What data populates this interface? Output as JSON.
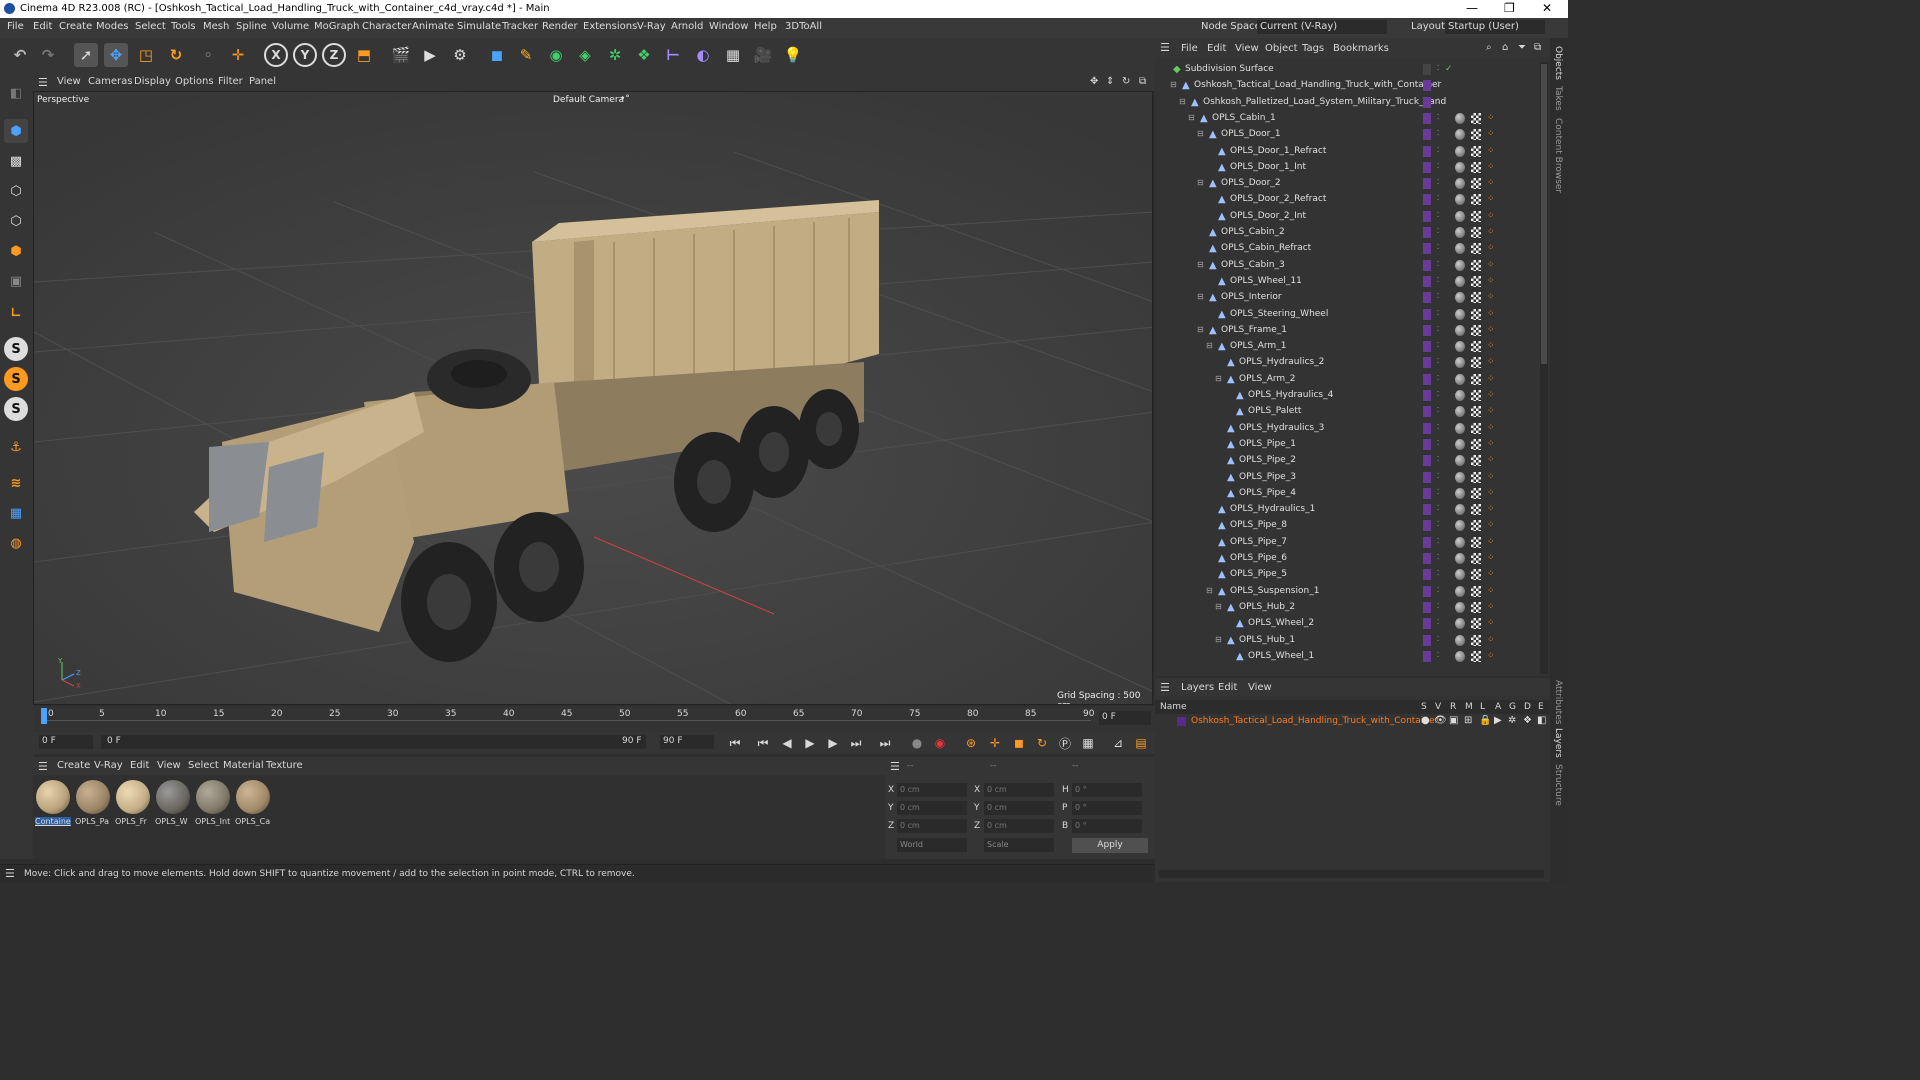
{
  "window": {
    "title": "Cinema 4D R23.008 (RC) - [Oshkosh_Tactical_Load_Handling_Truck_with_Container_c4d_vray.c4d *] - Main",
    "minimize": "—",
    "maximize": "❐",
    "close": "✕"
  },
  "menubar": {
    "items": [
      "File",
      "Edit",
      "Create",
      "Modes",
      "Select",
      "Tools",
      "Mesh",
      "Spline",
      "Volume",
      "MoGraph",
      "Character",
      "Animate",
      "Simulate",
      "Tracker",
      "Render",
      "Extensions",
      "V-Ray",
      "Arnold",
      "Window",
      "Help",
      "3DToAll"
    ],
    "node_space_label": "Node Space:",
    "node_space_value": "Current (V-Ray)",
    "layout_label": "Layout:",
    "layout_value": "Startup (User)"
  },
  "viewport": {
    "menu": [
      "View",
      "Cameras",
      "Display",
      "Options",
      "Filter",
      "Panel"
    ],
    "label": "Perspective",
    "camera": "Default Camera",
    "camera_icon": "•°",
    "grid_spacing": "Grid Spacing : 500 cm",
    "axis_y": "Y",
    "axis_z": "Z",
    "axis_x": "X"
  },
  "timeline": {
    "ticks": [
      "0",
      "5",
      "10",
      "15",
      "20",
      "25",
      "30",
      "35",
      "40",
      "45",
      "50",
      "55",
      "60",
      "65",
      "70",
      "75",
      "80",
      "85",
      "90"
    ],
    "current": "0 F"
  },
  "transport": {
    "start": "0 F",
    "range_start": "0 F",
    "range_end": "90 F",
    "end": "90 F"
  },
  "materials": {
    "menu": [
      "Create",
      "V-Ray",
      "Edit",
      "View",
      "Select",
      "Material",
      "Texture"
    ],
    "items": [
      {
        "label": "Containe",
        "color": "#b8a07a"
      },
      {
        "label": "OPLS_Pa",
        "color": "#9a8466"
      },
      {
        "label": "OPLS_Fr",
        "color": "#c4ad86"
      },
      {
        "label": "OPLS_W",
        "color": "#6a6660"
      },
      {
        "label": "OPLS_Int",
        "color": "#807868"
      },
      {
        "label": "OPLS_Ca",
        "color": "#a08a6a"
      }
    ]
  },
  "coords": {
    "header": [
      "--",
      "--",
      "--"
    ],
    "rows": [
      {
        "a": "X",
        "av": "0 cm",
        "b": "X",
        "bv": "0 cm",
        "c": "H",
        "cv": "0 °"
      },
      {
        "a": "Y",
        "av": "0 cm",
        "b": "Y",
        "bv": "0 cm",
        "c": "P",
        "cv": "0 °"
      },
      {
        "a": "Z",
        "av": "0 cm",
        "b": "Z",
        "bv": "0 cm",
        "c": "B",
        "cv": "0 °"
      }
    ],
    "world": "World",
    "scale": "Scale",
    "apply": "Apply"
  },
  "status": {
    "text": "Move: Click and drag to move elements. Hold down SHIFT to quantize movement / add to the selection in point mode, CTRL to remove."
  },
  "objects": {
    "menu": [
      "File",
      "Edit",
      "View",
      "Object",
      "Tags",
      "Bookmarks"
    ],
    "rows": [
      {
        "name": "Subdivision Surface",
        "indent": 0,
        "icon": "◆",
        "iconcolor": "#5fcf5f",
        "tags": false
      },
      {
        "name": "Oshkosh_Tactical_Load_Handling_Truck_with_Container",
        "indent": 1,
        "icon": "▲",
        "iconcolor": "#9ec0ff",
        "tags": false
      },
      {
        "name": "Oshkosh_Palletized_Load_System_Military_Truck_Sand",
        "indent": 2,
        "icon": "▲",
        "iconcolor": "#9ec0ff",
        "tags": false
      },
      {
        "name": "OPLS_Cabin_1",
        "indent": 3,
        "icon": "▲",
        "iconcolor": "#9ec0ff",
        "tags": true
      },
      {
        "name": "OPLS_Door_1",
        "indent": 4,
        "icon": "▲",
        "iconcolor": "#9ec0ff",
        "tags": true
      },
      {
        "name": "OPLS_Door_1_Refract",
        "indent": 5,
        "icon": "▲",
        "iconcolor": "#9ec0ff",
        "tags": true
      },
      {
        "name": "OPLS_Door_1_Int",
        "indent": 5,
        "icon": "▲",
        "iconcolor": "#9ec0ff",
        "tags": true
      },
      {
        "name": "OPLS_Door_2",
        "indent": 4,
        "icon": "▲",
        "iconcolor": "#9ec0ff",
        "tags": true
      },
      {
        "name": "OPLS_Door_2_Refract",
        "indent": 5,
        "icon": "▲",
        "iconcolor": "#9ec0ff",
        "tags": true
      },
      {
        "name": "OPLS_Door_2_Int",
        "indent": 5,
        "icon": "▲",
        "iconcolor": "#9ec0ff",
        "tags": true
      },
      {
        "name": "OPLS_Cabin_2",
        "indent": 4,
        "icon": "▲",
        "iconcolor": "#9ec0ff",
        "tags": true
      },
      {
        "name": "OPLS_Cabin_Refract",
        "indent": 4,
        "icon": "▲",
        "iconcolor": "#9ec0ff",
        "tags": true
      },
      {
        "name": "OPLS_Cabin_3",
        "indent": 4,
        "icon": "▲",
        "iconcolor": "#9ec0ff",
        "tags": true
      },
      {
        "name": "OPLS_Wheel_11",
        "indent": 5,
        "icon": "▲",
        "iconcolor": "#9ec0ff",
        "tags": true
      },
      {
        "name": "OPLS_Interior",
        "indent": 4,
        "icon": "▲",
        "iconcolor": "#9ec0ff",
        "tags": true
      },
      {
        "name": "OPLS_Steering_Wheel",
        "indent": 5,
        "icon": "▲",
        "iconcolor": "#9ec0ff",
        "tags": true
      },
      {
        "name": "OPLS_Frame_1",
        "indent": 4,
        "icon": "▲",
        "iconcolor": "#9ec0ff",
        "tags": true
      },
      {
        "name": "OPLS_Arm_1",
        "indent": 5,
        "icon": "▲",
        "iconcolor": "#9ec0ff",
        "tags": true
      },
      {
        "name": "OPLS_Hydraulics_2",
        "indent": 6,
        "icon": "▲",
        "iconcolor": "#9ec0ff",
        "tags": true
      },
      {
        "name": "OPLS_Arm_2",
        "indent": 6,
        "icon": "▲",
        "iconcolor": "#9ec0ff",
        "tags": true
      },
      {
        "name": "OPLS_Hydraulics_4",
        "indent": 7,
        "icon": "▲",
        "iconcolor": "#9ec0ff",
        "tags": true
      },
      {
        "name": "OPLS_Palett",
        "indent": 7,
        "icon": "▲",
        "iconcolor": "#9ec0ff",
        "tags": true
      },
      {
        "name": "OPLS_Hydraulics_3",
        "indent": 6,
        "icon": "▲",
        "iconcolor": "#9ec0ff",
        "tags": true
      },
      {
        "name": "OPLS_Pipe_1",
        "indent": 6,
        "icon": "▲",
        "iconcolor": "#9ec0ff",
        "tags": true
      },
      {
        "name": "OPLS_Pipe_2",
        "indent": 6,
        "icon": "▲",
        "iconcolor": "#9ec0ff",
        "tags": true
      },
      {
        "name": "OPLS_Pipe_3",
        "indent": 6,
        "icon": "▲",
        "iconcolor": "#9ec0ff",
        "tags": true
      },
      {
        "name": "OPLS_Pipe_4",
        "indent": 6,
        "icon": "▲",
        "iconcolor": "#9ec0ff",
        "tags": true
      },
      {
        "name": "OPLS_Hydraulics_1",
        "indent": 5,
        "icon": "▲",
        "iconcolor": "#9ec0ff",
        "tags": true
      },
      {
        "name": "OPLS_Pipe_8",
        "indent": 5,
        "icon": "▲",
        "iconcolor": "#9ec0ff",
        "tags": true
      },
      {
        "name": "OPLS_Pipe_7",
        "indent": 5,
        "icon": "▲",
        "iconcolor": "#9ec0ff",
        "tags": true
      },
      {
        "name": "OPLS_Pipe_6",
        "indent": 5,
        "icon": "▲",
        "iconcolor": "#9ec0ff",
        "tags": true
      },
      {
        "name": "OPLS_Pipe_5",
        "indent": 5,
        "icon": "▲",
        "iconcolor": "#9ec0ff",
        "tags": true
      },
      {
        "name": "OPLS_Suspension_1",
        "indent": 5,
        "icon": "▲",
        "iconcolor": "#9ec0ff",
        "tags": true
      },
      {
        "name": "OPLS_Hub_2",
        "indent": 6,
        "icon": "▲",
        "iconcolor": "#9ec0ff",
        "tags": true
      },
      {
        "name": "OPLS_Wheel_2",
        "indent": 7,
        "icon": "▲",
        "iconcolor": "#9ec0ff",
        "tags": true
      },
      {
        "name": "OPLS_Hub_1",
        "indent": 6,
        "icon": "▲",
        "iconcolor": "#9ec0ff",
        "tags": true
      },
      {
        "name": "OPLS_Wheel_1",
        "indent": 7,
        "icon": "▲",
        "iconcolor": "#9ec0ff",
        "tags": true
      }
    ]
  },
  "layers": {
    "menu": [
      "Layers",
      "Edit",
      "View"
    ],
    "columns": [
      "Name",
      "S",
      "V",
      "R",
      "M",
      "L",
      "A",
      "G",
      "D",
      "E"
    ],
    "rows": [
      {
        "name": "Oshkosh_Tactical_Load_Handling_Truck_with_Container",
        "color": "#ff7a1a"
      }
    ]
  },
  "sidetabs": [
    "Objects",
    "Takes",
    "Content Browser",
    "Attributes",
    "Layers",
    "Structure"
  ],
  "colors": {
    "accent": "#ff7a1a",
    "layer_purple": "#5a2a8a",
    "tag_purple": "#6a3a9a"
  }
}
